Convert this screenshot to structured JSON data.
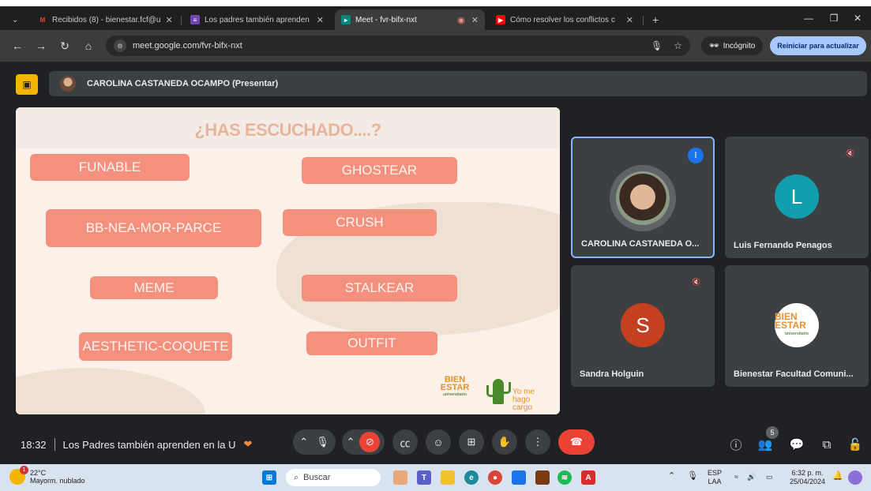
{
  "browser": {
    "tabs": [
      {
        "title": "Recibidos (8) - bienestar.fcf@u",
        "favicon": "gmail-icon"
      },
      {
        "title": "Los padres también aprenden",
        "favicon": "forms-icon"
      },
      {
        "title": "Meet - fvr-bifx-nxt",
        "favicon": "meet-icon"
      },
      {
        "title": "Cómo resolver los conflictos c",
        "favicon": "youtube-icon"
      }
    ],
    "url": "meet.google.com/fvr-bifx-nxt",
    "incognito_label": "Incógnito",
    "update_label": "Reiniciar para actualizar"
  },
  "meet": {
    "presenter_label": "CAROLINA CASTANEDA OCAMPO (Presentar)",
    "slide": {
      "title": "¿HAS ESCUCHADO....?",
      "words": [
        "FUNABLE",
        "GHOSTEAR",
        "BB-NEA-MOR-PARCE",
        "CRUSH",
        "MEME",
        "STALKEAR",
        "AESTHETIC-COQUETE",
        "OUTFIT"
      ],
      "logo_bienestar": "BIEN ESTAR",
      "logo_bienestar_sub": "universitario",
      "logo_yome": "Yo me hago cargo"
    },
    "participants": [
      {
        "name": "CAROLINA CASTANEDA O...",
        "initial": "",
        "color": "#5f6368"
      },
      {
        "name": "Luis Fernando Penagos",
        "initial": "L",
        "color": "#129eaf"
      },
      {
        "name": "Sandra Holguin",
        "initial": "S",
        "color": "#c5401f"
      },
      {
        "name": "Bienestar Facultad Comuni...",
        "initial": "",
        "color": "#ffffff"
      }
    ],
    "bienestar_avatar": "BIEN ESTAR",
    "bienestar_avatar_sub": "universitario",
    "time": "18:32",
    "meeting_title": "Los Padres también aprenden en la U",
    "people_count": "5",
    "colors": {
      "pill": "#f4917e",
      "end_call": "#ea4335",
      "accent": "#1a73e8"
    }
  },
  "taskbar": {
    "temperature": "22°C",
    "weather_desc": "Mayorm. nublado",
    "weather_badge": "1",
    "search_placeholder": "Buscar",
    "lang_top": "ESP",
    "lang_bottom": "LAA",
    "clock_time": "6:32 p. m.",
    "clock_date": "25/04/2024"
  }
}
